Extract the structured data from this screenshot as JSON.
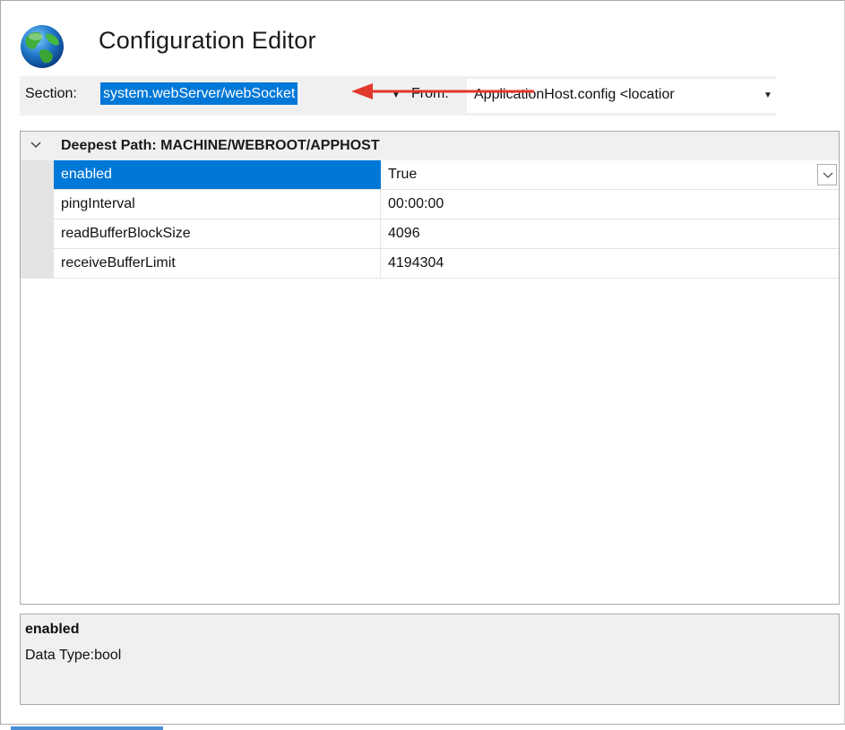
{
  "header": {
    "title": "Configuration Editor",
    "icon": "globe-icon"
  },
  "toolbar": {
    "section_label": "Section:",
    "section_value": "system.webServer/webSocket",
    "from_label": "From:",
    "from_value": "ApplicationHost.config <locatior"
  },
  "grid": {
    "group_title": "Deepest Path: MACHINE/WEBROOT/APPHOST",
    "rows": [
      {
        "name": "enabled",
        "value": "True",
        "selected": true
      },
      {
        "name": "pingInterval",
        "value": "00:00:00",
        "selected": false
      },
      {
        "name": "readBufferBlockSize",
        "value": "4096",
        "selected": false
      },
      {
        "name": "receiveBufferLimit",
        "value": "4194304",
        "selected": false
      }
    ]
  },
  "info": {
    "title": "enabled",
    "text": "Data Type:bool"
  },
  "colors": {
    "selection": "#0078d7",
    "annotation_arrow": "#e0392b"
  }
}
